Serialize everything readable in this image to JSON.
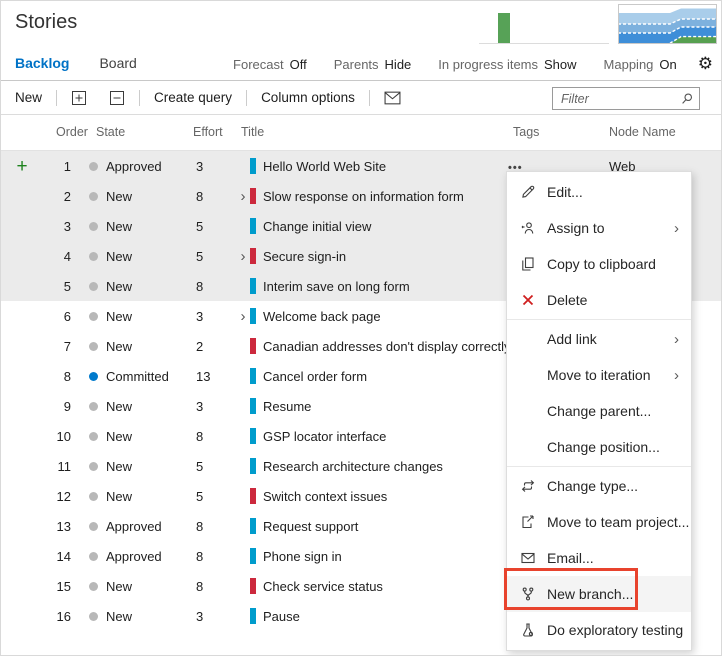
{
  "colors": {
    "accent_blue": "#0072c6",
    "story_bar": "#009CCC",
    "bug_bar": "#CC293D",
    "committed_dot": "#007acc",
    "default_state_dot": "#b8b8b8",
    "selected_row_bg": "#ebebeb",
    "add_button_green": "#1d821d",
    "callout_red": "#e8432d",
    "velocity_bar_green": "#57a257"
  },
  "header": {
    "title": "Stories",
    "tabs": [
      {
        "label": "Backlog",
        "active": true
      },
      {
        "label": "Board",
        "active": false
      }
    ],
    "view_controls": [
      {
        "label": "Forecast",
        "value": "Off"
      },
      {
        "label": "Parents",
        "value": "Hide"
      },
      {
        "label": "In progress items",
        "value": "Show"
      },
      {
        "label": "Mapping",
        "value": "On"
      }
    ],
    "charts": {
      "velocity_thumbnail": {
        "type": "bar",
        "bars": 1,
        "bar_color": "#57a257"
      },
      "cumulative_flow_thumbnail": {
        "type": "area",
        "band_colors": [
          "#a9cdea",
          "#7db1de",
          "#3e8ed8",
          "#57a050"
        ]
      }
    }
  },
  "toolbar": {
    "new_label": "New",
    "create_query_label": "Create query",
    "column_options_label": "Column options",
    "filter": {
      "placeholder": "Filter",
      "value": ""
    }
  },
  "grid": {
    "columns": [
      "Order",
      "State",
      "Effort",
      "Title",
      "Tags",
      "Node Name"
    ],
    "rows": [
      {
        "order": "1",
        "state": "Approved",
        "effort": "3",
        "title": "Hello World Web Site",
        "type": "story",
        "children": false,
        "selected": true,
        "node": "Web",
        "add": true,
        "menu": true
      },
      {
        "order": "2",
        "state": "New",
        "effort": "8",
        "title": "Slow response on information form",
        "type": "bug",
        "children": true,
        "selected": true
      },
      {
        "order": "3",
        "state": "New",
        "effort": "5",
        "title": "Change initial view",
        "type": "story",
        "children": false,
        "selected": true
      },
      {
        "order": "4",
        "state": "New",
        "effort": "5",
        "title": "Secure sign-in",
        "type": "bug",
        "children": true,
        "selected": true
      },
      {
        "order": "5",
        "state": "New",
        "effort": "8",
        "title": "Interim save on long form",
        "type": "story",
        "children": false,
        "selected": true
      },
      {
        "order": "6",
        "state": "New",
        "effort": "3",
        "title": "Welcome back page",
        "type": "story",
        "children": true,
        "selected": false
      },
      {
        "order": "7",
        "state": "New",
        "effort": "2",
        "title": "Canadian addresses don't display correctly",
        "type": "bug",
        "children": false,
        "selected": false
      },
      {
        "order": "8",
        "state": "Committed",
        "effort": "13",
        "title": "Cancel order form",
        "type": "story",
        "children": false,
        "selected": false
      },
      {
        "order": "9",
        "state": "New",
        "effort": "3",
        "title": "Resume",
        "type": "story",
        "children": false,
        "selected": false
      },
      {
        "order": "10",
        "state": "New",
        "effort": "8",
        "title": "GSP locator interface",
        "type": "story",
        "children": false,
        "selected": false
      },
      {
        "order": "11",
        "state": "New",
        "effort": "5",
        "title": "Research architecture changes",
        "type": "story",
        "children": false,
        "selected": false
      },
      {
        "order": "12",
        "state": "New",
        "effort": "5",
        "title": "Switch context issues",
        "type": "bug",
        "children": false,
        "selected": false
      },
      {
        "order": "13",
        "state": "Approved",
        "effort": "8",
        "title": "Request support",
        "type": "story",
        "children": false,
        "selected": false
      },
      {
        "order": "14",
        "state": "Approved",
        "effort": "8",
        "title": "Phone sign in",
        "type": "story",
        "children": false,
        "selected": false
      },
      {
        "order": "15",
        "state": "New",
        "effort": "8",
        "title": "Check service status",
        "type": "bug",
        "children": false,
        "selected": false
      },
      {
        "order": "16",
        "state": "New",
        "effort": "3",
        "title": "Pause",
        "type": "story",
        "children": false,
        "selected": false
      }
    ]
  },
  "context_menu": {
    "items": [
      {
        "label": "Edit...",
        "icon": "pencil"
      },
      {
        "label": "Assign to",
        "icon": "assign",
        "submenu": true
      },
      {
        "label": "Copy to clipboard",
        "icon": "copy"
      },
      {
        "label": "Delete",
        "icon": "delete",
        "separator_after": true
      },
      {
        "label": "Add link",
        "submenu": true
      },
      {
        "label": "Move to iteration",
        "submenu": true
      },
      {
        "label": "Change parent..."
      },
      {
        "label": "Change position...",
        "separator_after": true
      },
      {
        "label": "Change type...",
        "icon": "change-type"
      },
      {
        "label": "Move to team project...",
        "icon": "move-project"
      },
      {
        "label": "Email...",
        "icon": "envelope"
      },
      {
        "label": "New branch...",
        "icon": "branch",
        "highlighted": true
      },
      {
        "label": "Do exploratory testing",
        "icon": "beaker"
      }
    ]
  }
}
